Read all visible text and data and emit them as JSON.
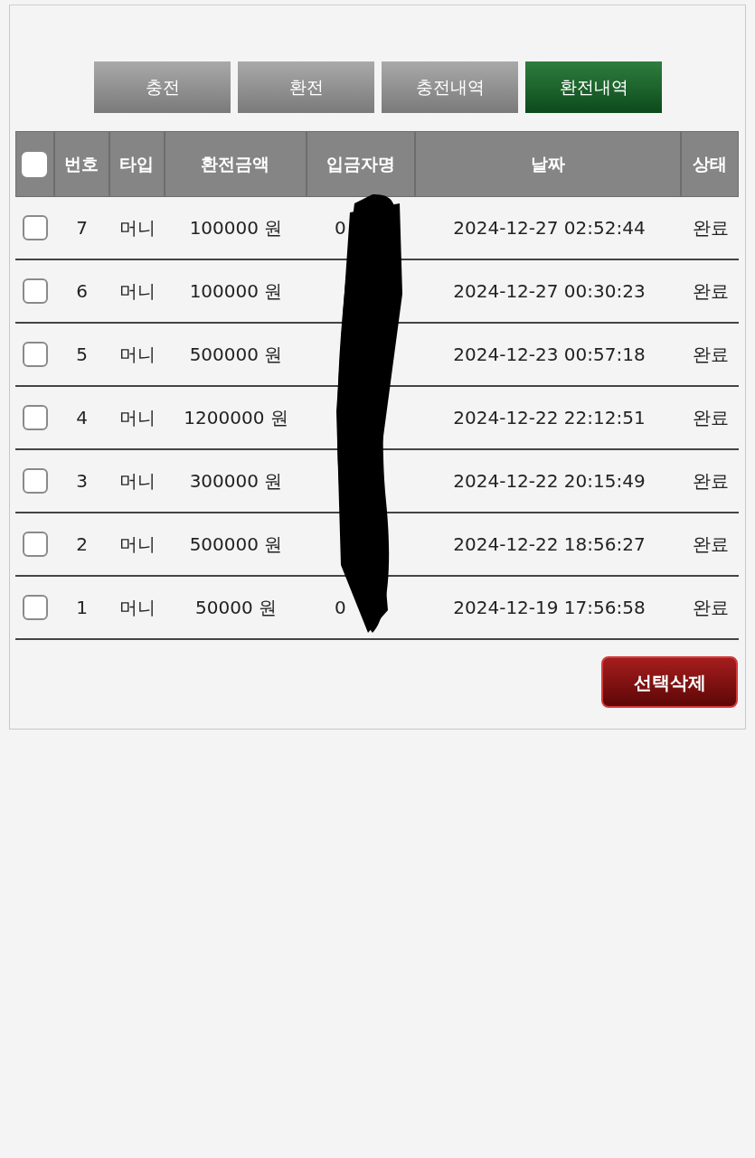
{
  "tabs": [
    {
      "label": "충전",
      "selected": false
    },
    {
      "label": "환전",
      "selected": false
    },
    {
      "label": "충전내역",
      "selected": false
    },
    {
      "label": "환전내역",
      "selected": true
    }
  ],
  "table": {
    "select_all": {
      "checked": false
    },
    "columns": [
      "번호",
      "타입",
      "환전금액",
      "입금자명",
      "날짜",
      "상태"
    ],
    "rows": [
      {
        "checked": false,
        "number": "7",
        "type": "머니",
        "amount": "100000 원",
        "depositor": "0",
        "date": "2024-12-27 02:52:44",
        "status": "완료"
      },
      {
        "checked": false,
        "number": "6",
        "type": "머니",
        "amount": "100000 원",
        "date": "2024-12-27 00:30:23",
        "status": "완료"
      },
      {
        "checked": false,
        "number": "5",
        "type": "머니",
        "amount": "500000 원",
        "date": "2024-12-23 00:57:18",
        "status": "완료"
      },
      {
        "checked": false,
        "number": "4",
        "type": "머니",
        "amount": "1200000 원",
        "date": "2024-12-22 22:12:51",
        "status": "완료"
      },
      {
        "checked": false,
        "number": "3",
        "type": "머니",
        "amount": "300000 원",
        "date": "2024-12-22 20:15:49",
        "status": "완료"
      },
      {
        "checked": false,
        "number": "2",
        "type": "머니",
        "amount": "500000 원",
        "date": "2024-12-22 18:56:27",
        "status": "완료"
      },
      {
        "checked": false,
        "number": "1",
        "type": "머니",
        "amount": "50000 원",
        "depositor": "0",
        "date": "2024-12-19 17:56:58",
        "status": "완료"
      }
    ]
  },
  "delete_button": "선택삭제"
}
